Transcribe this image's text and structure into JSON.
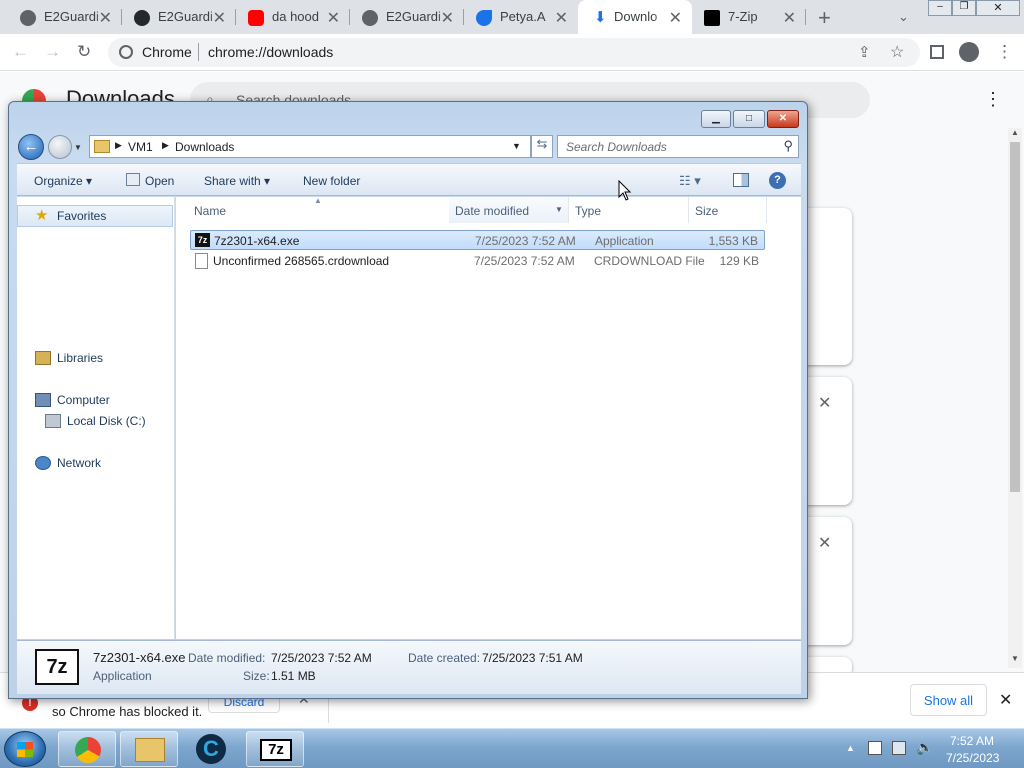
{
  "tabs": [
    {
      "title": "E2Guardi",
      "icon": "globe-icon"
    },
    {
      "title": "E2Guardi",
      "icon": "github-icon"
    },
    {
      "title": "da hood",
      "icon": "youtube-icon"
    },
    {
      "title": "E2Guardi",
      "icon": "globe-icon"
    },
    {
      "title": "Petya.A",
      "icon": "petya-icon"
    },
    {
      "title": "Downlo",
      "icon": "download-icon"
    },
    {
      "title": "7-Zip",
      "icon": "7zip-icon"
    }
  ],
  "omnibox": {
    "site": "Chrome",
    "url": "chrome://downloads"
  },
  "downloads_page": {
    "title": "Downloads",
    "search_placeholder": "Search downloads",
    "blocked_text": "so Chrome has blocked it.",
    "discard_label": "Discard",
    "show_all_label": "Show all"
  },
  "explorer": {
    "breadcrumb": [
      "VM1",
      "Downloads"
    ],
    "search_placeholder": "Search Downloads",
    "commands": {
      "organize": "Organize",
      "open": "Open",
      "share_with": "Share with",
      "new_folder": "New folder"
    },
    "nav": {
      "favorites": "Favorites",
      "libraries": "Libraries",
      "computer": "Computer",
      "local_disk": "Local Disk (C:)",
      "network": "Network"
    },
    "columns": {
      "name": "Name",
      "date": "Date modified",
      "type": "Type",
      "size": "Size"
    },
    "files": [
      {
        "name": "7z2301-x64.exe",
        "date": "7/25/2023 7:52 AM",
        "type": "Application",
        "size": "1,553 KB",
        "selected": true
      },
      {
        "name": "Unconfirmed 268565.crdownload",
        "date": "7/25/2023 7:52 AM",
        "type": "CRDOWNLOAD File",
        "size": "129 KB",
        "selected": false
      }
    ],
    "details": {
      "name": "7z2301-x64.exe",
      "kind": "Application",
      "modified_label": "Date modified:",
      "modified": "7/25/2023 7:52 AM",
      "created_label": "Date created:",
      "created": "7/25/2023 7:51 AM",
      "size_label": "Size:",
      "size": "1.51 MB"
    }
  },
  "taskbar": {
    "time": "7:52 AM",
    "date": "7/25/2023"
  }
}
